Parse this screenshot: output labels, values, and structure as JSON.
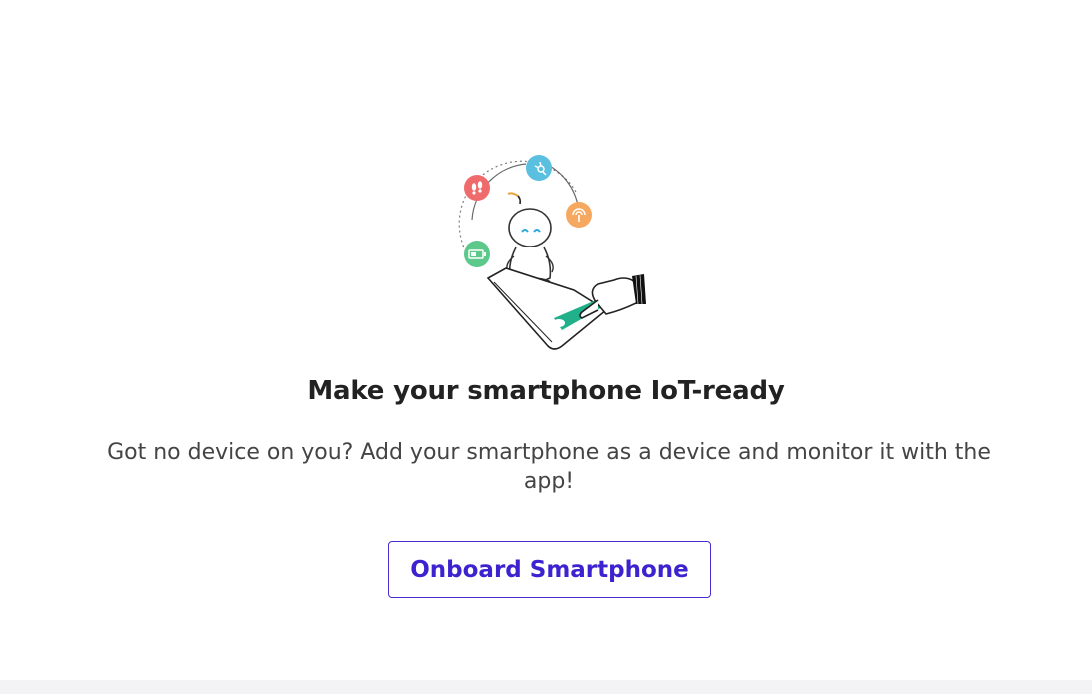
{
  "onboarding": {
    "title": "Make your smartphone IoT-ready",
    "description": "Got no device on you? Add your smartphone as a device and monitor it with the app!",
    "cta_label": "Onboard Smartphone"
  },
  "illustration": {
    "icons": [
      "footsteps-icon",
      "share-network-icon",
      "signal-icon",
      "battery-icon"
    ],
    "colors": {
      "footsteps": "#f06b6b",
      "network": "#5bbfe0",
      "signal": "#f7a860",
      "battery": "#5cc98b",
      "phone_screen": "#20b08a"
    }
  },
  "colors": {
    "accent": "#3d22cf",
    "title": "#222222",
    "text": "#444444"
  }
}
